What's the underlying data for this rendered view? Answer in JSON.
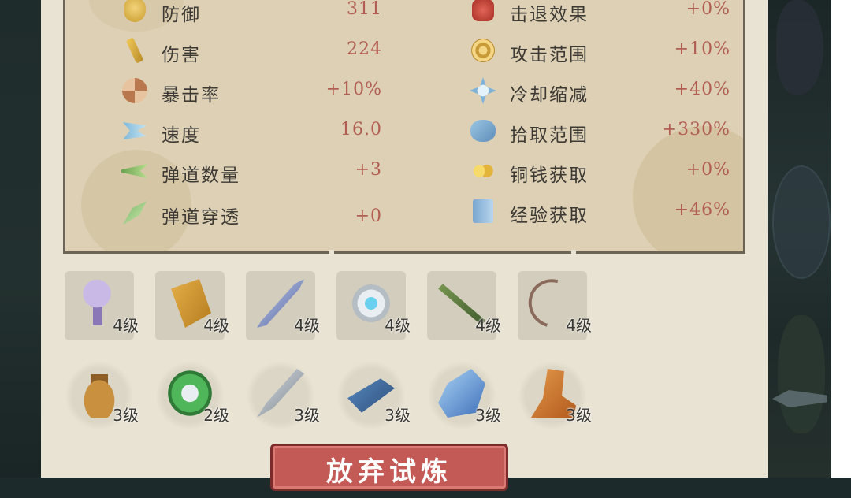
{
  "stats": {
    "left": [
      {
        "icon": "defense-icon",
        "name": "防御",
        "value": "311"
      },
      {
        "icon": "damage-icon",
        "name": "伤害",
        "value": "224"
      },
      {
        "icon": "crit-rate-icon",
        "name": "暴击率",
        "value": "+10%"
      },
      {
        "icon": "speed-icon",
        "name": "速度",
        "value": "16.0"
      },
      {
        "icon": "projectile-count-icon",
        "name": "弹道数量",
        "value": "+3"
      },
      {
        "icon": "projectile-pierce-icon",
        "name": "弹道穿透",
        "value": "+0"
      }
    ],
    "right": [
      {
        "icon": "knockback-icon",
        "name": "击退效果",
        "value": "+0%"
      },
      {
        "icon": "attack-range-icon",
        "name": "攻击范围",
        "value": "+10%"
      },
      {
        "icon": "cooldown-icon",
        "name": "冷却缩减",
        "value": "+40%"
      },
      {
        "icon": "pickup-range-icon",
        "name": "拾取范围",
        "value": "+330%"
      },
      {
        "icon": "copper-coin-icon",
        "name": "铜钱获取",
        "value": "+0%"
      },
      {
        "icon": "experience-icon",
        "name": "经验获取",
        "value": "+46%"
      }
    ]
  },
  "items": {
    "row1": [
      {
        "icon": "jade-charm-icon",
        "level": "4级"
      },
      {
        "icon": "talisman-scroll-icon",
        "level": "4级"
      },
      {
        "icon": "blue-sword-icon",
        "level": "4级"
      },
      {
        "icon": "silver-ring-icon",
        "level": "4级"
      },
      {
        "icon": "bamboo-flute-icon",
        "level": "4级"
      },
      {
        "icon": "bow-icon",
        "level": "4级"
      }
    ],
    "row2": [
      {
        "icon": "pouch-icon",
        "level": "3级"
      },
      {
        "icon": "jade-bracelet-icon",
        "level": "2级"
      },
      {
        "icon": "dagger-icon",
        "level": "3级"
      },
      {
        "icon": "book-icon",
        "level": "3级"
      },
      {
        "icon": "crystal-icon",
        "level": "3级"
      },
      {
        "icon": "boot-icon",
        "level": "3级"
      }
    ]
  },
  "abandon_button": "放弃试炼"
}
